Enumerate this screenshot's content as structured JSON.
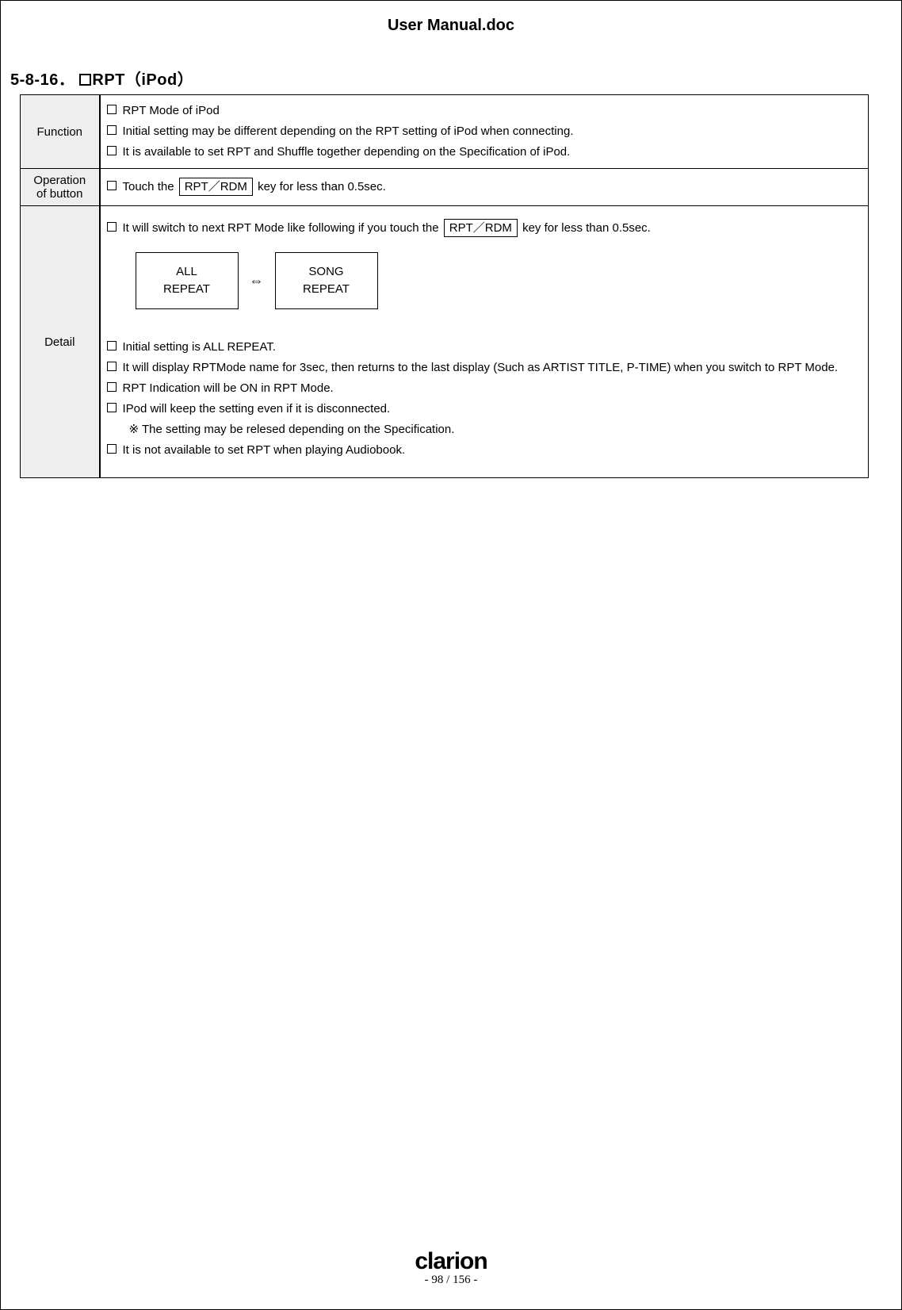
{
  "doc_title": "User Manual.doc",
  "section_number": "5-8-16．",
  "section_title": "RPT（iPod）",
  "rows": {
    "function": {
      "label": "Function",
      "items": [
        "RPT Mode of iPod",
        "Initial setting may be different depending on the RPT setting of iPod when connecting.",
        "It is available to set RPT and Shuffle together depending on the Specification of iPod."
      ]
    },
    "operation": {
      "label": "Operation of button",
      "prefix": "Touch the",
      "key": "RPT／RDM",
      "suffix": "key for less than 0.5sec."
    },
    "detail": {
      "label": "Detail",
      "intro_prefix": "It will switch to next RPT Mode like following if you touch the",
      "intro_key": "RPT／RDM",
      "intro_suffix": "key for less than 0.5sec.",
      "mode_a_line1": "ALL",
      "mode_a_line2": "REPEAT",
      "arrow": "⇔",
      "mode_b_line1": "SONG",
      "mode_b_line2": "REPEAT",
      "items": [
        "Initial setting is ALL REPEAT.",
        "It will display RPTMode name for 3sec, then returns to the last display (Such as ARTIST TITLE, P-TIME) when you switch to RPT Mode.",
        "RPT Indication will be ON in RPT Mode.",
        "IPod will keep the setting even if it is disconnected."
      ],
      "note": "※ The setting may be relesed depending on the Specification.",
      "last_item": "It is not available to set RPT when playing Audiobook."
    }
  },
  "footer": {
    "brand": "clarion",
    "page": "- 98 / 156 -"
  }
}
